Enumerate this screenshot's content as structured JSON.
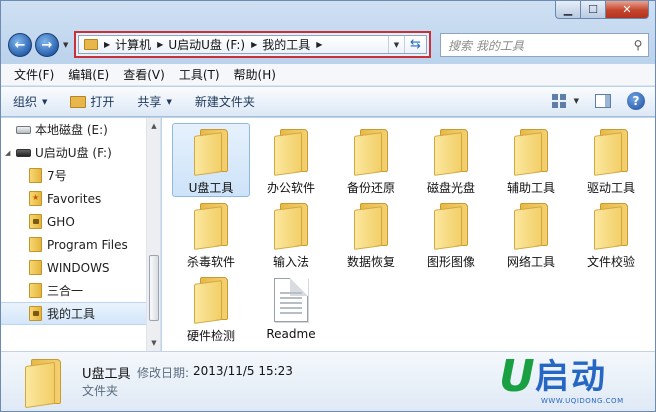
{
  "address_bar": {
    "crumbs": [
      "计算机",
      "U启动U盘 (F:)",
      "我的工具"
    ]
  },
  "search": {
    "placeholder": "搜索 我的工具"
  },
  "menu": [
    "文件(F)",
    "编辑(E)",
    "查看(V)",
    "工具(T)",
    "帮助(H)"
  ],
  "toolbar": {
    "organize": "组织",
    "open": "打开",
    "share": "共享",
    "new_folder": "新建文件夹"
  },
  "nav_pane": {
    "drives": [
      {
        "label": "本地磁盘 (E:)",
        "icon": "hard-drive-icon"
      },
      {
        "label": "U启动U盘 (F:)",
        "icon": "usb-drive-icon"
      }
    ],
    "folders": [
      {
        "label": "7号",
        "icon": "folder-icon"
      },
      {
        "label": "Favorites",
        "icon": "favorites-folder-icon"
      },
      {
        "label": "GHO",
        "icon": "locked-folder-icon"
      },
      {
        "label": "Program Files",
        "icon": "folder-icon"
      },
      {
        "label": "WINDOWS",
        "icon": "folder-icon"
      },
      {
        "label": "三合一",
        "icon": "folder-icon"
      },
      {
        "label": "我的工具",
        "icon": "locked-folder-icon",
        "selected": true
      }
    ]
  },
  "files": [
    {
      "name": "U盘工具",
      "type": "folder",
      "selected": true
    },
    {
      "name": "办公软件",
      "type": "folder"
    },
    {
      "name": "备份还原",
      "type": "folder"
    },
    {
      "name": "磁盘光盘",
      "type": "folder"
    },
    {
      "name": "辅助工具",
      "type": "folder"
    },
    {
      "name": "驱动工具",
      "type": "folder"
    },
    {
      "name": "杀毒软件",
      "type": "folder"
    },
    {
      "name": "输入法",
      "type": "folder"
    },
    {
      "name": "数据恢复",
      "type": "folder"
    },
    {
      "name": "图形图像",
      "type": "folder"
    },
    {
      "name": "网络工具",
      "type": "folder"
    },
    {
      "name": "文件校验",
      "type": "folder"
    },
    {
      "name": "硬件检测",
      "type": "folder"
    },
    {
      "name": "Readme",
      "type": "document"
    }
  ],
  "details": {
    "name": "U盘工具",
    "date_label": "修改日期:",
    "date": "2013/11/5 15:23",
    "type": "文件夹"
  },
  "watermark": {
    "text": "启动",
    "letter": "U",
    "url": "WWW.UQIDONG.COM"
  },
  "colors": {
    "address_highlight": "#c8303a",
    "selection": "#cde3f9",
    "logo_green": "#18a042",
    "logo_blue": "#2667c4"
  }
}
